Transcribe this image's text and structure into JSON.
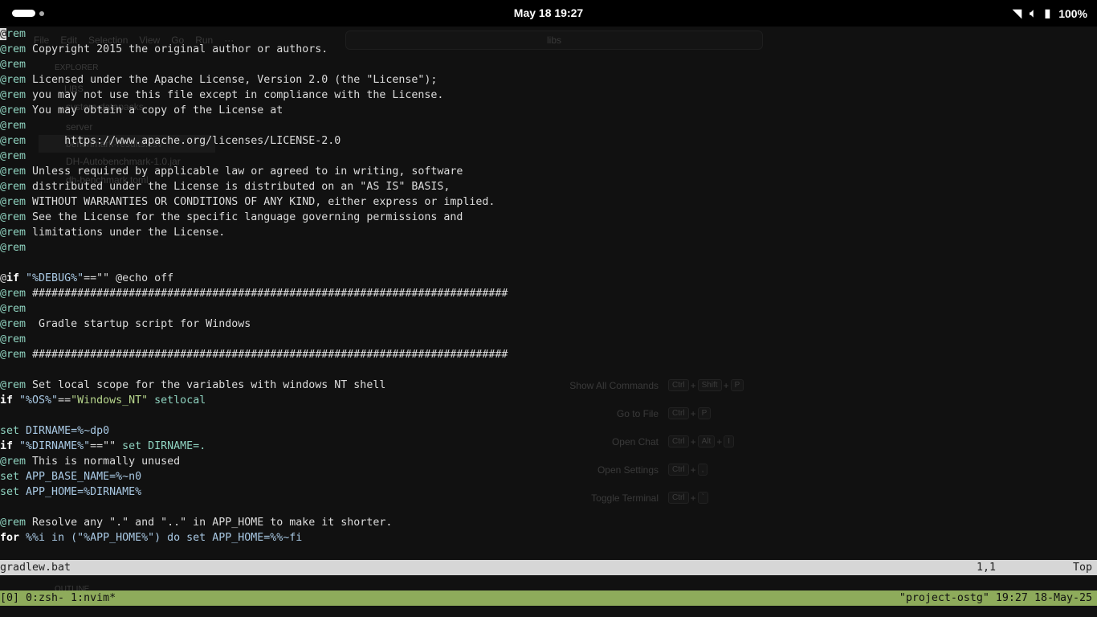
{
  "system_bar": {
    "clock": "May 18  19:27",
    "battery": "100%"
  },
  "background_app": {
    "menu": [
      "File",
      "Edit",
      "Selection",
      "View",
      "Go",
      "Run",
      "···"
    ],
    "search": "libs",
    "explorer_title": "EXPLORER",
    "root": "LIBS",
    "tree": [
      "system-datapacks",
      "server",
      "benchmark-results.csv",
      "DH-Autobenchmark-1.0.jar",
      "dh-benchmark.toml"
    ],
    "outline": "OUTLINE",
    "shortcuts": [
      {
        "label": "Show All Commands",
        "keys": [
          "Ctrl",
          "Shift",
          "P"
        ]
      },
      {
        "label": "Go to File",
        "keys": [
          "Ctrl",
          "P"
        ]
      },
      {
        "label": "Open Chat",
        "keys": [
          "Ctrl",
          "Alt",
          "I"
        ]
      },
      {
        "label": "Open Settings",
        "keys": [
          "Ctrl",
          ","
        ]
      },
      {
        "label": "Toggle Terminal",
        "keys": [
          "Ctrl",
          "`"
        ]
      }
    ]
  },
  "editor": {
    "lines": [
      [
        [
          "@rem",
          "rem"
        ]
      ],
      [
        [
          "@rem",
          "rem"
        ],
        [
          " Copyright 2015 the original author or authors.",
          "cm"
        ]
      ],
      [
        [
          "@rem",
          "rem"
        ]
      ],
      [
        [
          "@rem",
          "rem"
        ],
        [
          " Licensed under the Apache License, Version 2.0 (the \"License\");",
          "cm"
        ]
      ],
      [
        [
          "@rem",
          "rem"
        ],
        [
          " you may not use this file except in compliance with the License.",
          "cm"
        ]
      ],
      [
        [
          "@rem",
          "rem"
        ],
        [
          " You may obtain a copy of the License at",
          "cm"
        ]
      ],
      [
        [
          "@rem",
          "rem"
        ]
      ],
      [
        [
          "@rem",
          "rem"
        ],
        [
          "      https://www.apache.org/licenses/LICENSE-2.0",
          "cm"
        ]
      ],
      [
        [
          "@rem",
          "rem"
        ]
      ],
      [
        [
          "@rem",
          "rem"
        ],
        [
          " Unless required by applicable law or agreed to in writing, software",
          "cm"
        ]
      ],
      [
        [
          "@rem",
          "rem"
        ],
        [
          " distributed under the License is distributed on an \"AS IS\" BASIS,",
          "cm"
        ]
      ],
      [
        [
          "@rem",
          "rem"
        ],
        [
          " WITHOUT WARRANTIES OR CONDITIONS OF ANY KIND, either express or implied.",
          "cm"
        ]
      ],
      [
        [
          "@rem",
          "rem"
        ],
        [
          " See the License for the specific language governing permissions and",
          "cm"
        ]
      ],
      [
        [
          "@rem",
          "rem"
        ],
        [
          " limitations under the License.",
          "cm"
        ]
      ],
      [
        [
          "@rem",
          "rem"
        ]
      ],
      [],
      [
        [
          "@",
          "plain"
        ],
        [
          "if",
          "kw"
        ],
        [
          " \"%DEBUG%\"",
          "str"
        ],
        [
          "==\"\" ",
          "plain"
        ],
        [
          "@echo off",
          "cm"
        ]
      ],
      [
        [
          "@rem",
          "rem"
        ],
        [
          " ##########################################################################",
          "cm"
        ]
      ],
      [
        [
          "@rem",
          "rem"
        ]
      ],
      [
        [
          "@rem",
          "rem"
        ],
        [
          "  Gradle startup script for Windows",
          "cm"
        ]
      ],
      [
        [
          "@rem",
          "rem"
        ]
      ],
      [
        [
          "@rem",
          "rem"
        ],
        [
          " ##########################################################################",
          "cm"
        ]
      ],
      [],
      [
        [
          "@rem",
          "rem"
        ],
        [
          " Set local scope for the variables with windows NT shell",
          "cm"
        ]
      ],
      [
        [
          "if",
          "kw"
        ],
        [
          " \"%OS%\"",
          "str"
        ],
        [
          "==",
          "plain"
        ],
        [
          "\"Windows_NT\"",
          "grn"
        ],
        [
          " setlocal",
          "set"
        ]
      ],
      [],
      [
        [
          "set",
          "set"
        ],
        [
          " DIRNAME=%~dp0",
          "var"
        ]
      ],
      [
        [
          "if",
          "kw"
        ],
        [
          " \"%DIRNAME%\"",
          "str"
        ],
        [
          "==\"\" ",
          "plain"
        ],
        [
          "set DIRNAME=.",
          "set"
        ]
      ],
      [
        [
          "@rem",
          "rem"
        ],
        [
          " This is normally unused",
          "cm"
        ]
      ],
      [
        [
          "set",
          "set"
        ],
        [
          " APP_BASE_NAME=%~n0",
          "var"
        ]
      ],
      [
        [
          "set",
          "set"
        ],
        [
          " APP_HOME=%DIRNAME%",
          "var"
        ]
      ],
      [],
      [
        [
          "@rem",
          "rem"
        ],
        [
          " Resolve any \".\" and \"..\" in APP_HOME to make it shorter.",
          "cm"
        ]
      ],
      [
        [
          "for",
          "kw"
        ],
        [
          " %%i in (\"%APP_HOME%\") do set APP_HOME=%%~fi",
          "var"
        ]
      ]
    ]
  },
  "statusline": {
    "filename": "gradlew.bat",
    "position": "1,1",
    "scroll": "Top"
  },
  "tmux": {
    "windows": "[0] 0:zsh- 1:nvim*",
    "session": "\"project-ostg\" 19:27 18-May-25"
  }
}
